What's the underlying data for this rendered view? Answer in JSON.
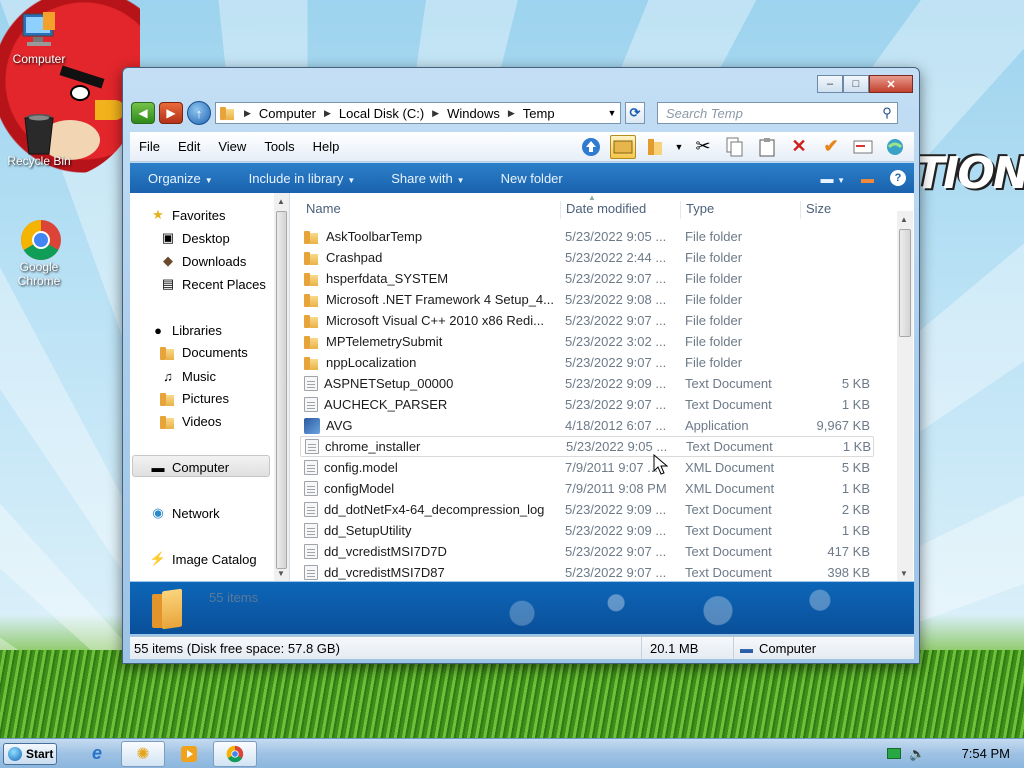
{
  "desktop": {
    "icons": [
      {
        "label": "Computer",
        "icon": "computer-icon"
      },
      {
        "label": "Recycle Bin",
        "icon": "recycle-bin-icon"
      },
      {
        "label": "Google Chrome",
        "icon": "chrome-icon"
      }
    ]
  },
  "window": {
    "buttons": {
      "minimize": "–",
      "maximize": "□",
      "close": "✕"
    },
    "breadcrumb": [
      "Computer",
      "Local Disk (C:)",
      "Windows",
      "Temp"
    ],
    "search_placeholder": "Search Temp",
    "menu": [
      "File",
      "Edit",
      "View",
      "Tools",
      "Help"
    ],
    "commands": [
      "Organize",
      "Include in library",
      "Share with",
      "New folder"
    ],
    "nav": {
      "favorites": "Favorites",
      "favorites_items": [
        "Desktop",
        "Downloads",
        "Recent Places"
      ],
      "libraries": "Libraries",
      "libraries_items": [
        "Documents",
        "Music",
        "Pictures",
        "Videos"
      ],
      "computer": "Computer",
      "network": "Network",
      "image_catalog": "Image Catalog"
    },
    "columns": {
      "name": "Name",
      "date": "Date modified",
      "type": "Type",
      "size": "Size"
    },
    "files": [
      {
        "name": "AskToolbarTemp",
        "date": "5/23/2022 9:05 ...",
        "type": "File folder",
        "size": "",
        "icon": "folder"
      },
      {
        "name": "Crashpad",
        "date": "5/23/2022 2:44 ...",
        "type": "File folder",
        "size": "",
        "icon": "folder"
      },
      {
        "name": "hsperfdata_SYSTEM",
        "date": "5/23/2022 9:07 ...",
        "type": "File folder",
        "size": "",
        "icon": "folder"
      },
      {
        "name": "Microsoft .NET Framework 4 Setup_4...",
        "date": "5/23/2022 9:08 ...",
        "type": "File folder",
        "size": "",
        "icon": "folder"
      },
      {
        "name": "Microsoft Visual C++ 2010  x86 Redi...",
        "date": "5/23/2022 9:07 ...",
        "type": "File folder",
        "size": "",
        "icon": "folder"
      },
      {
        "name": "MPTelemetrySubmit",
        "date": "5/23/2022 3:02 ...",
        "type": "File folder",
        "size": "",
        "icon": "folder"
      },
      {
        "name": "nppLocalization",
        "date": "5/23/2022 9:07 ...",
        "type": "File folder",
        "size": "",
        "icon": "folder"
      },
      {
        "name": "ASPNETSetup_00000",
        "date": "5/23/2022 9:09 ...",
        "type": "Text Document",
        "size": "5 KB",
        "icon": "doc"
      },
      {
        "name": "AUCHECK_PARSER",
        "date": "5/23/2022 9:07 ...",
        "type": "Text Document",
        "size": "1 KB",
        "icon": "doc"
      },
      {
        "name": "AVG",
        "date": "4/18/2012 6:07 ...",
        "type": "Application",
        "size": "9,967 KB",
        "icon": "app"
      },
      {
        "name": "chrome_installer",
        "date": "5/23/2022 9:05 ...",
        "type": "Text Document",
        "size": "1 KB",
        "icon": "doc"
      },
      {
        "name": "config.model",
        "date": "7/9/2011 9:07 ...",
        "type": "XML Document",
        "size": "5 KB",
        "icon": "doc"
      },
      {
        "name": "configModel",
        "date": "7/9/2011 9:08 PM",
        "type": "XML Document",
        "size": "1 KB",
        "icon": "doc"
      },
      {
        "name": "dd_dotNetFx4-64_decompression_log",
        "date": "5/23/2022 9:09 ...",
        "type": "Text Document",
        "size": "2 KB",
        "icon": "doc"
      },
      {
        "name": "dd_SetupUtility",
        "date": "5/23/2022 9:09 ...",
        "type": "Text Document",
        "size": "1 KB",
        "icon": "doc"
      },
      {
        "name": "dd_vcredistMSI7D7D",
        "date": "5/23/2022 9:07 ...",
        "type": "Text Document",
        "size": "417 KB",
        "icon": "doc"
      },
      {
        "name": "dd_vcredistMSI7D87",
        "date": "5/23/2022 9:07 ...",
        "type": "Text Document",
        "size": "398 KB",
        "icon": "doc"
      }
    ],
    "details_count": "55 items",
    "status": {
      "items": "55 items (Disk free space: 57.8 GB)",
      "size": "20.1 MB",
      "location": "Computer"
    }
  },
  "taskbar": {
    "start_label": "Start",
    "clock": "7:54 PM"
  },
  "colors": {
    "accent": "#1a62ae",
    "title_bar": "#aacdec",
    "close_button": "#c2402d"
  }
}
